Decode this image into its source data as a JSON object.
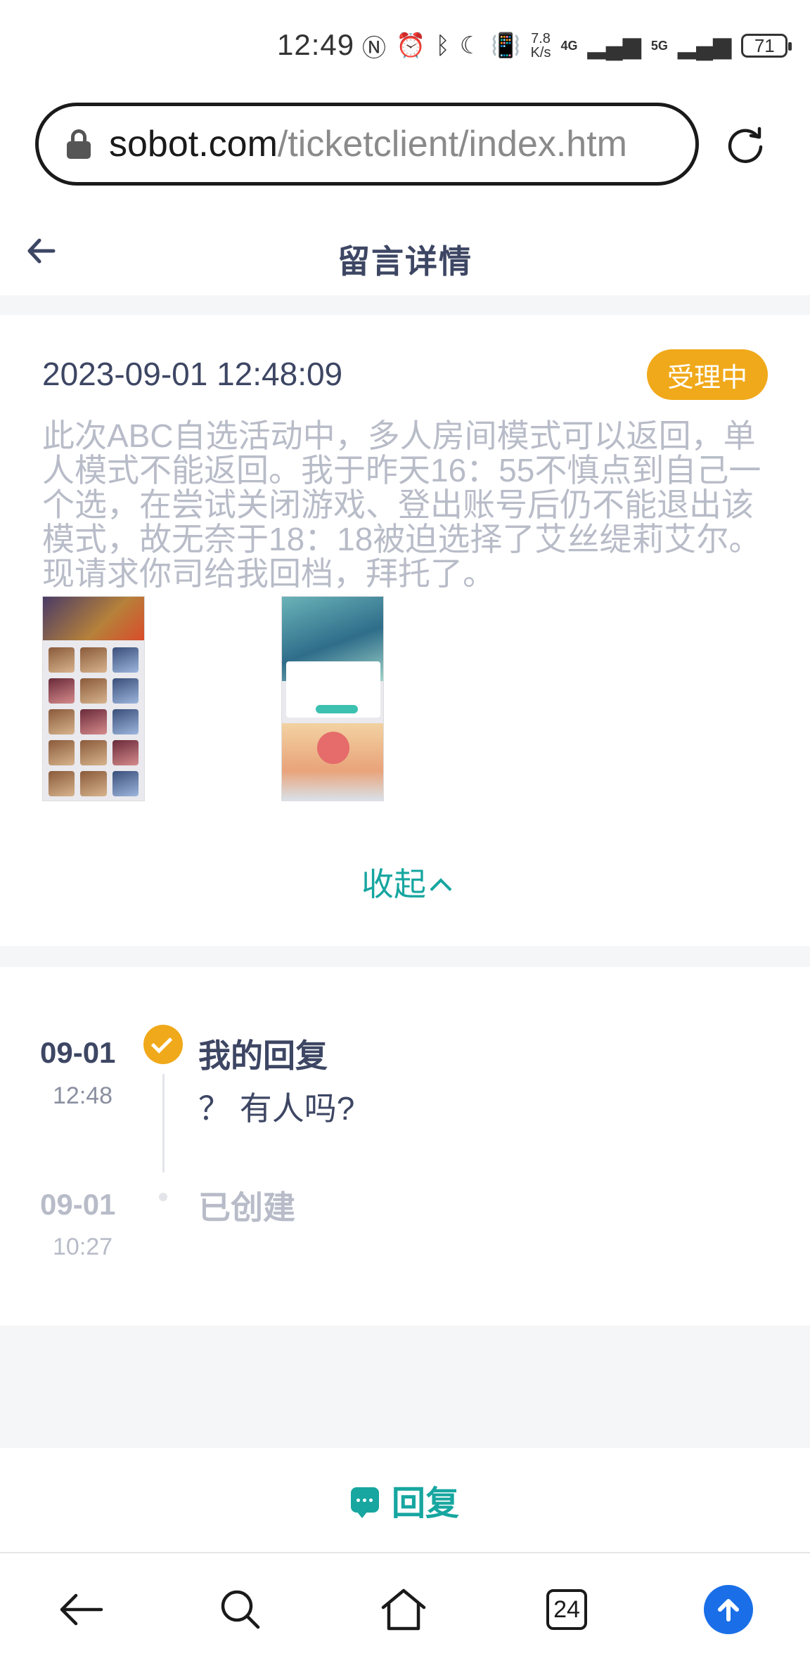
{
  "status_bar": {
    "time": "12:49",
    "net_speed_top": "7.8",
    "net_speed_bottom": "K/s",
    "network_4g": "4G",
    "network_5g": "5G",
    "battery": "71"
  },
  "browser": {
    "url_domain": "sobot.com",
    "url_path": "/ticketclient/index.htm",
    "tabs_count": "24"
  },
  "header": {
    "title": "留言详情"
  },
  "ticket": {
    "date": "2023-09-01 12:48:09",
    "status": "受理中",
    "status_color": "#f0a91a",
    "body": "此次ABC自选活动中，多人房间模式可以返回，单人模式不能返回。我于昨天16：55不慎点到自己一个选，在尝试关闭游戏、登出账号后仍不能退出该模式，故无奈于18：18被迫选择了艾丝缇莉艾尔。现请求你司给我回档，拜托了。",
    "collapse_label": "收起"
  },
  "timeline": [
    {
      "date": "09-01",
      "time": "12:48",
      "title": "我的回复",
      "content": "？ 有人吗?"
    },
    {
      "date": "09-01",
      "time": "10:27",
      "title": "已创建"
    }
  ],
  "reply": {
    "label": "回复"
  },
  "colors": {
    "accent": "#17a6a0",
    "title": "#3d4663",
    "muted": "#b8bcc8",
    "upload": "#1a6fe8"
  }
}
